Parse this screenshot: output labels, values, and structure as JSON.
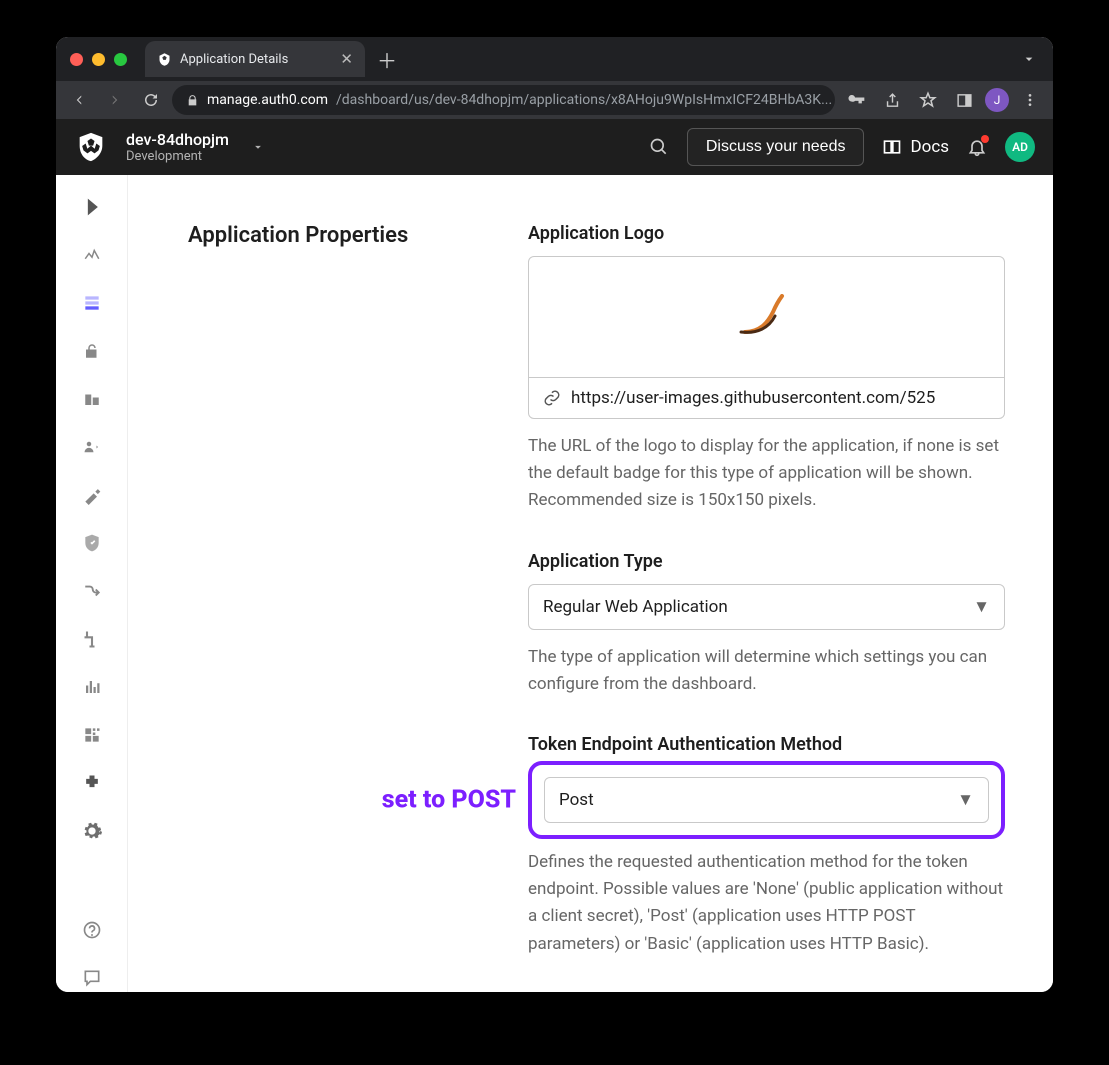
{
  "browser": {
    "tab_title": "Application Details",
    "url_host": "manage.auth0.com",
    "url_path": "/dashboard/us/dev-84dhopjm/applications/x8AHoju9WpIsHmxICF24BHbA3K...",
    "profile_initial": "J"
  },
  "topbar": {
    "tenant_name": "dev-84dhopjm",
    "tenant_env": "Development",
    "discuss_label": "Discuss your needs",
    "docs_label": "Docs",
    "avatar_initials": "AD"
  },
  "section": {
    "title": "Application Properties"
  },
  "logo": {
    "label": "Application Logo",
    "url_value": "https://user-images.githubusercontent.com/525",
    "help": "The URL of the logo to display for the application, if none is set the default badge for this type of application will be shown. Recommended size is 150x150 pixels."
  },
  "app_type": {
    "label": "Application Type",
    "value": "Regular Web Application",
    "help": "The type of application will determine which settings you can configure from the dashboard."
  },
  "token_auth": {
    "label": "Token Endpoint Authentication Method",
    "value": "Post",
    "help": "Defines the requested authentication method for the token endpoint. Possible values are 'None' (public application without a client secret), 'Post' (application uses HTTP POST parameters) or 'Basic' (application uses HTTP Basic).",
    "callout": "set to POST"
  }
}
